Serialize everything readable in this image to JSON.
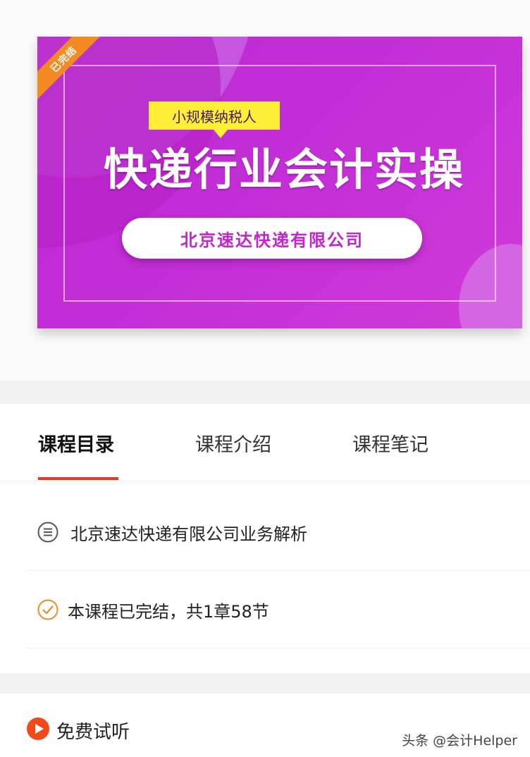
{
  "banner": {
    "ribbon": "已完结",
    "tag": "小规模纳税人",
    "title": "快递行业会计实操",
    "company": "北京速达快递有限公司"
  },
  "tabs": [
    {
      "label": "课程目录",
      "active": true
    },
    {
      "label": "课程介绍",
      "active": false
    },
    {
      "label": "课程笔记",
      "active": false
    }
  ],
  "rows": [
    {
      "icon": "list-icon",
      "text": "北京速达快递有限公司业务解析"
    },
    {
      "icon": "check-circle-icon",
      "text": "本课程已完结，共1章58节"
    }
  ],
  "bottom": {
    "icon": "play-icon",
    "label": "免费试听",
    "watermark": "头条 @会计Helper"
  },
  "colors": {
    "banner": "#c12ed6",
    "tag": "#ffef36",
    "ribbon": "#f58a23",
    "accent": "#e8371e",
    "check": "#f08a24",
    "play": "#f04a1a"
  }
}
